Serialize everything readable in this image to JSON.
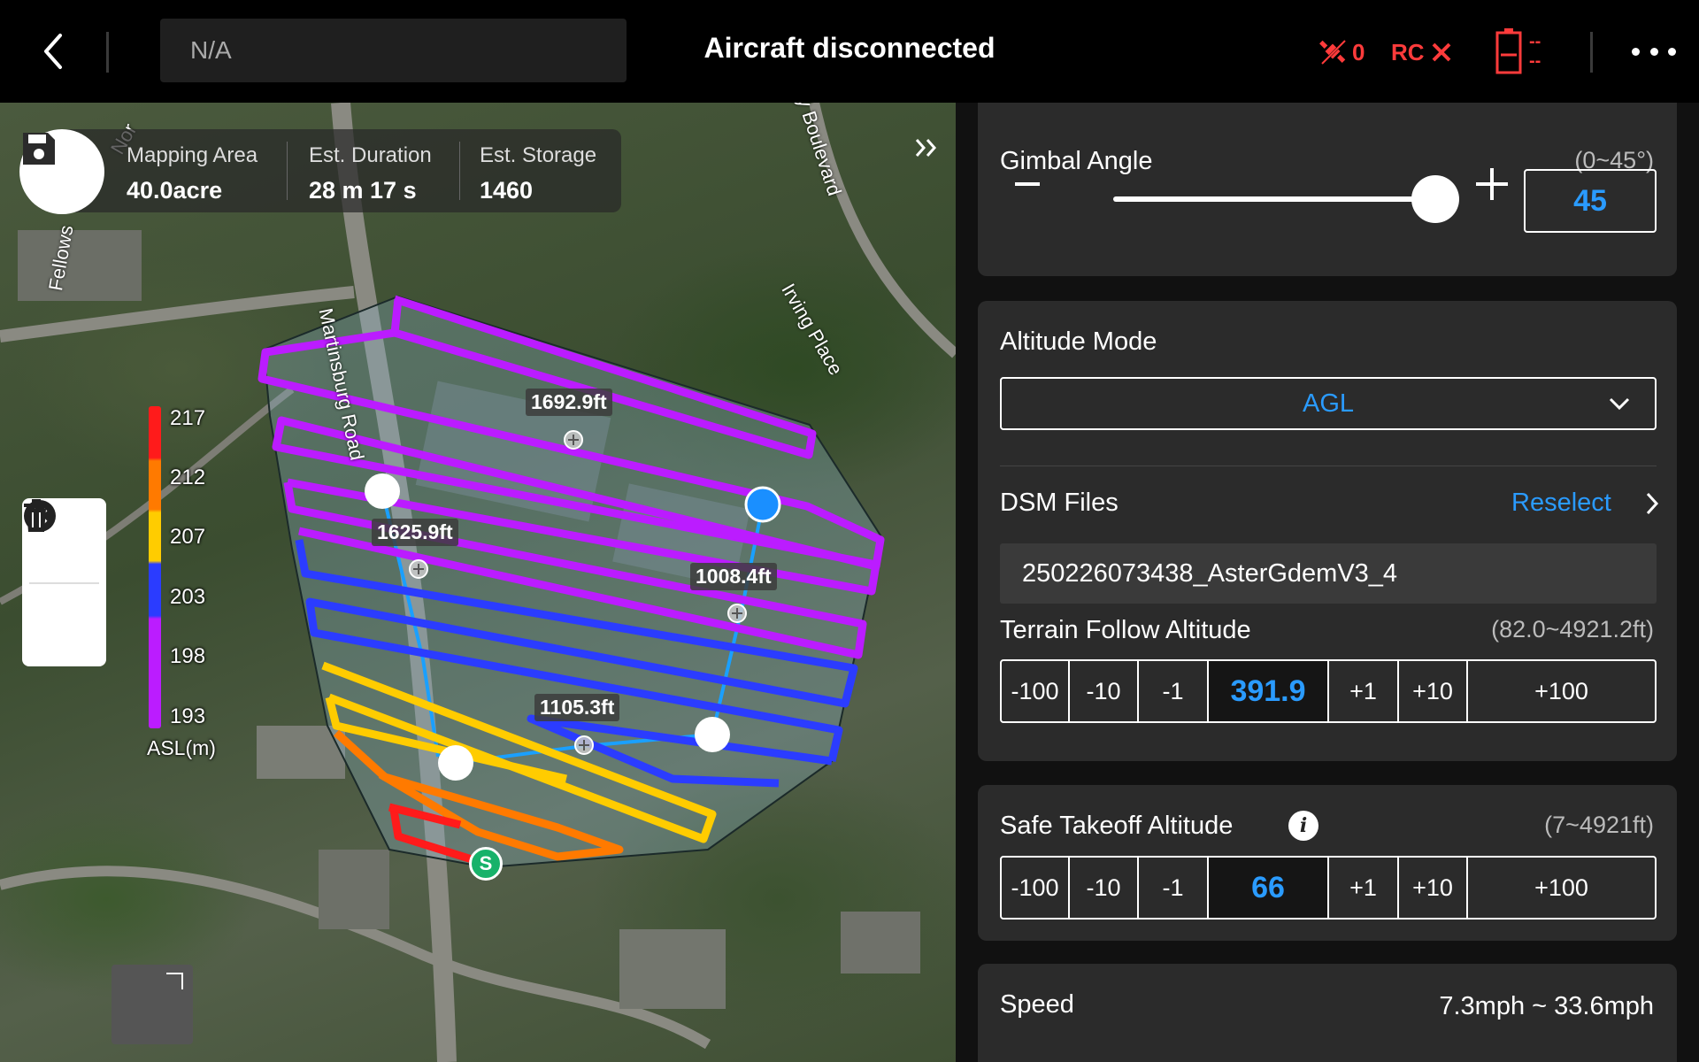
{
  "header": {
    "mission_name": "N/A",
    "status_title": "Aircraft disconnected",
    "gps_count": "0",
    "rc_label": "RC",
    "battery_text": "--"
  },
  "map": {
    "stats": [
      {
        "label": "Mapping Area",
        "value": "40.0acre"
      },
      {
        "label": "Est. Duration",
        "value": "28 m 17 s"
      },
      {
        "label": "Est. Storage",
        "value": "1460"
      }
    ],
    "legend": {
      "ticks": [
        "217",
        "212",
        "207",
        "203",
        "198",
        "193"
      ],
      "unit": "ASL(m)",
      "colors": [
        "#ff1b1b",
        "#ff7a00",
        "#ffcc00",
        "#2b3cff",
        "#bb1cff"
      ]
    },
    "distances": [
      "1692.9ft",
      "1625.9ft",
      "1008.4ft",
      "1105.3ft"
    ],
    "start_marker": "S",
    "road_labels": [
      "Martinsburg Road",
      "Irving Place",
      "Fellows",
      "y Boulevard",
      "Nor"
    ]
  },
  "panel": {
    "gimbal": {
      "label": "Gimbal Angle",
      "range": "(0~45°)",
      "value": "45",
      "level": 1.0
    },
    "altitude_mode": {
      "label": "Altitude Mode",
      "value": "AGL"
    },
    "dsm": {
      "label": "DSM Files",
      "action": "Reselect",
      "file": "250226073438_AsterGdemV3_4"
    },
    "terrain": {
      "label": "Terrain Follow Altitude",
      "range": "(82.0~4921.2ft)",
      "value": "391.9",
      "steps": [
        "-100",
        "-10",
        "-1",
        "+1",
        "+10",
        "+100"
      ]
    },
    "safe_takeoff": {
      "label": "Safe Takeoff Altitude",
      "range": "(7~4921ft)",
      "value": "66",
      "steps": [
        "-100",
        "-10",
        "-1",
        "+1",
        "+10",
        "+100"
      ]
    },
    "speed": {
      "label": "Speed",
      "value": "7.3mph ~ 33.6mph"
    }
  },
  "colors": {
    "accent": "#2a9bff",
    "alert": "#ff3b3b"
  }
}
